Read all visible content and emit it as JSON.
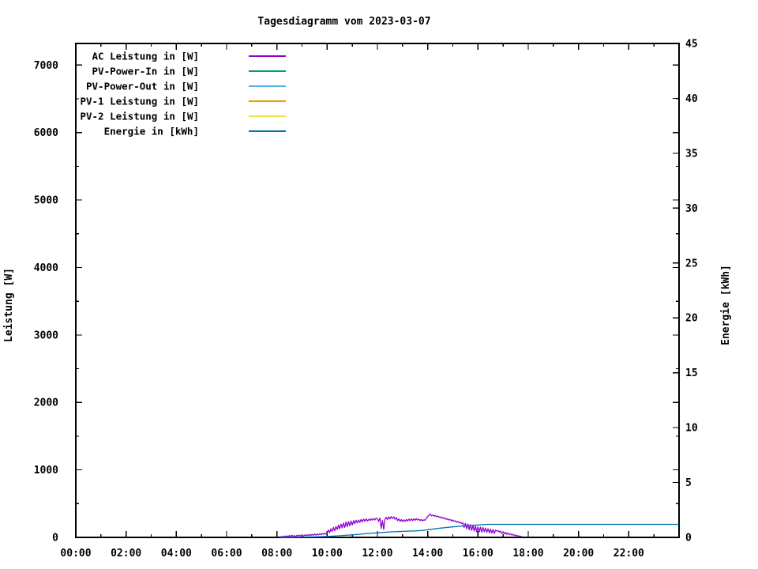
{
  "title": "Tagesdiagramm vom 2023-03-07",
  "chart_data": {
    "type": "line",
    "title": "Tagesdiagramm vom 2023-03-07",
    "grid": false,
    "legend_position": "top-left-inside",
    "x_axis": {
      "unit": "time of day",
      "range_hours": [
        0,
        24
      ],
      "major_tick_step_hours": 2,
      "minor_tick_step_hours": 1,
      "tick_labels": [
        "00:00",
        "02:00",
        "04:00",
        "06:00",
        "08:00",
        "10:00",
        "12:00",
        "14:00",
        "16:00",
        "18:00",
        "20:00",
        "22:00"
      ],
      "tick_label_hours": [
        0,
        2,
        4,
        6,
        8,
        10,
        12,
        14,
        16,
        18,
        20,
        22
      ]
    },
    "y_left": {
      "title": "Leistung [W]",
      "range": [
        0,
        7320
      ],
      "major_tick_step": 1000,
      "minor_tick_step": 500,
      "tick_values": [
        0,
        1000,
        2000,
        3000,
        4000,
        5000,
        6000,
        7000
      ],
      "tick_labels": [
        "0",
        "1000",
        "2000",
        "3000",
        "4000",
        "5000",
        "6000",
        "7000"
      ]
    },
    "y_right": {
      "title": "Energie [kWh]",
      "range": [
        0,
        45
      ],
      "major_tick_step": 5,
      "tick_values": [
        0,
        5,
        10,
        15,
        20,
        25,
        30,
        35,
        40,
        45
      ],
      "tick_labels": [
        "0",
        "5",
        "10",
        "15",
        "20",
        "25",
        "30",
        "35",
        "40",
        "45"
      ]
    },
    "series": [
      {
        "name": "AC Leistung in [W]",
        "color": "#9400d3",
        "axis": "left",
        "unit": "W",
        "note": "noisy daylight curve ~08:10-17:45, peak ~345 W around 14:05",
        "points": [
          [
            8.15,
            3
          ],
          [
            8.2,
            15
          ],
          [
            8.25,
            6
          ],
          [
            8.3,
            20
          ],
          [
            8.35,
            10
          ],
          [
            8.4,
            24
          ],
          [
            8.45,
            12
          ],
          [
            8.5,
            28
          ],
          [
            8.55,
            14
          ],
          [
            8.6,
            30
          ],
          [
            8.65,
            16
          ],
          [
            8.7,
            26
          ],
          [
            8.75,
            12
          ],
          [
            8.8,
            32
          ],
          [
            8.85,
            18
          ],
          [
            8.9,
            34
          ],
          [
            8.95,
            20
          ],
          [
            9.0,
            30
          ],
          [
            9.05,
            16
          ],
          [
            9.1,
            36
          ],
          [
            9.15,
            22
          ],
          [
            9.2,
            40
          ],
          [
            9.25,
            26
          ],
          [
            9.3,
            44
          ],
          [
            9.35,
            28
          ],
          [
            9.4,
            46
          ],
          [
            9.45,
            30
          ],
          [
            9.5,
            50
          ],
          [
            9.55,
            34
          ],
          [
            9.6,
            52
          ],
          [
            9.65,
            36
          ],
          [
            9.7,
            55
          ],
          [
            9.75,
            40
          ],
          [
            9.8,
            58
          ],
          [
            9.85,
            44
          ],
          [
            9.9,
            62
          ],
          [
            9.95,
            50
          ],
          [
            10.0,
            68
          ],
          [
            10.05,
            108
          ],
          [
            10.1,
            72
          ],
          [
            10.15,
            128
          ],
          [
            10.2,
            88
          ],
          [
            10.25,
            148
          ],
          [
            10.3,
            98
          ],
          [
            10.35,
            162
          ],
          [
            10.4,
            118
          ],
          [
            10.45,
            182
          ],
          [
            10.5,
            128
          ],
          [
            10.55,
            198
          ],
          [
            10.6,
            142
          ],
          [
            10.65,
            212
          ],
          [
            10.7,
            148
          ],
          [
            10.75,
            228
          ],
          [
            10.8,
            158
          ],
          [
            10.85,
            234
          ],
          [
            10.9,
            172
          ],
          [
            10.95,
            242
          ],
          [
            11.0,
            184
          ],
          [
            11.05,
            248
          ],
          [
            11.1,
            204
          ],
          [
            11.15,
            254
          ],
          [
            11.2,
            214
          ],
          [
            11.25,
            258
          ],
          [
            11.3,
            224
          ],
          [
            11.35,
            266
          ],
          [
            11.4,
            230
          ],
          [
            11.45,
            270
          ],
          [
            11.5,
            240
          ],
          [
            11.55,
            274
          ],
          [
            11.6,
            244
          ],
          [
            11.65,
            268
          ],
          [
            11.7,
            250
          ],
          [
            11.75,
            276
          ],
          [
            11.8,
            254
          ],
          [
            11.85,
            280
          ],
          [
            11.9,
            258
          ],
          [
            11.95,
            284
          ],
          [
            12.0,
            274
          ],
          [
            12.05,
            238
          ],
          [
            12.1,
            288
          ],
          [
            12.15,
            134
          ],
          [
            12.2,
            248
          ],
          [
            12.25,
            118
          ],
          [
            12.3,
            268
          ],
          [
            12.35,
            298
          ],
          [
            12.4,
            264
          ],
          [
            12.45,
            304
          ],
          [
            12.5,
            274
          ],
          [
            12.55,
            308
          ],
          [
            12.6,
            280
          ],
          [
            12.65,
            304
          ],
          [
            12.7,
            268
          ],
          [
            12.75,
            294
          ],
          [
            12.8,
            248
          ],
          [
            12.85,
            274
          ],
          [
            12.9,
            238
          ],
          [
            12.95,
            264
          ],
          [
            13.0,
            234
          ],
          [
            13.05,
            260
          ],
          [
            13.1,
            238
          ],
          [
            13.15,
            266
          ],
          [
            13.2,
            244
          ],
          [
            13.25,
            270
          ],
          [
            13.3,
            248
          ],
          [
            13.35,
            274
          ],
          [
            13.4,
            250
          ],
          [
            13.45,
            276
          ],
          [
            13.5,
            254
          ],
          [
            13.55,
            278
          ],
          [
            13.6,
            256
          ],
          [
            13.65,
            270
          ],
          [
            13.7,
            250
          ],
          [
            13.75,
            266
          ],
          [
            13.8,
            246
          ],
          [
            13.85,
            260
          ],
          [
            13.9,
            254
          ],
          [
            13.95,
            284
          ],
          [
            14.0,
            308
          ],
          [
            14.05,
            330
          ],
          [
            14.1,
            345
          ],
          [
            14.15,
            318
          ],
          [
            14.2,
            334
          ],
          [
            14.25,
            314
          ],
          [
            14.3,
            326
          ],
          [
            14.35,
            304
          ],
          [
            14.4,
            316
          ],
          [
            14.45,
            296
          ],
          [
            14.5,
            306
          ],
          [
            14.55,
            286
          ],
          [
            14.6,
            296
          ],
          [
            14.65,
            276
          ],
          [
            14.7,
            286
          ],
          [
            14.75,
            266
          ],
          [
            14.8,
            276
          ],
          [
            14.85,
            256
          ],
          [
            14.9,
            266
          ],
          [
            14.95,
            246
          ],
          [
            15.0,
            256
          ],
          [
            15.05,
            236
          ],
          [
            15.1,
            246
          ],
          [
            15.15,
            226
          ],
          [
            15.2,
            236
          ],
          [
            15.25,
            216
          ],
          [
            15.3,
            226
          ],
          [
            15.35,
            206
          ],
          [
            15.4,
            216
          ],
          [
            15.45,
            148
          ],
          [
            15.5,
            208
          ],
          [
            15.55,
            128
          ],
          [
            15.6,
            198
          ],
          [
            15.65,
            114
          ],
          [
            15.7,
            188
          ],
          [
            15.75,
            104
          ],
          [
            15.8,
            178
          ],
          [
            15.85,
            94
          ],
          [
            15.9,
            168
          ],
          [
            15.95,
            86
          ],
          [
            16.0,
            158
          ],
          [
            16.05,
            80
          ],
          [
            16.1,
            152
          ],
          [
            16.15,
            76
          ],
          [
            16.2,
            146
          ],
          [
            16.25,
            84
          ],
          [
            16.3,
            138
          ],
          [
            16.35,
            74
          ],
          [
            16.4,
            128
          ],
          [
            16.45,
            68
          ],
          [
            16.5,
            122
          ],
          [
            16.55,
            64
          ],
          [
            16.6,
            116
          ],
          [
            16.65,
            58
          ],
          [
            16.7,
            108
          ],
          [
            16.75,
            92
          ],
          [
            16.8,
            102
          ],
          [
            16.85,
            78
          ],
          [
            16.9,
            94
          ],
          [
            16.95,
            58
          ],
          [
            17.0,
            84
          ],
          [
            17.05,
            54
          ],
          [
            17.1,
            74
          ],
          [
            17.15,
            46
          ],
          [
            17.2,
            64
          ],
          [
            17.25,
            40
          ],
          [
            17.3,
            54
          ],
          [
            17.35,
            34
          ],
          [
            17.4,
            44
          ],
          [
            17.45,
            26
          ],
          [
            17.5,
            36
          ],
          [
            17.55,
            20
          ],
          [
            17.6,
            26
          ],
          [
            17.65,
            14
          ],
          [
            17.7,
            16
          ],
          [
            17.75,
            6
          ]
        ]
      },
      {
        "name": "PV-Power-In in [W]",
        "color": "#009e73",
        "axis": "left",
        "unit": "W",
        "note": "no visible curve (0 all day)",
        "points": []
      },
      {
        "name": "PV-Power-Out in [W]",
        "color": "#56b4e9",
        "axis": "left",
        "unit": "W",
        "note": "no visible curve (0 all day)",
        "points": []
      },
      {
        "name": "PV-1 Leistung in [W]",
        "color": "#e69f00",
        "axis": "left",
        "unit": "W",
        "note": "no visible curve (0 all day)",
        "points": []
      },
      {
        "name": "PV-2 Leistung in [W]",
        "color": "#f0e442",
        "axis": "left",
        "unit": "W",
        "note": "no visible curve (0 all day)",
        "points": []
      },
      {
        "name": "Energie in [kWh]",
        "color": "#0072b2",
        "axis": "right",
        "unit": "kWh",
        "note": "cumulative energy, rises from ~08:15 to plateau ~1.19 kWh at ~16:25",
        "points": [
          [
            8.15,
            0
          ],
          [
            8.5,
            0.01
          ],
          [
            9.0,
            0.03
          ],
          [
            9.5,
            0.05
          ],
          [
            10.0,
            0.09
          ],
          [
            10.5,
            0.15
          ],
          [
            11.0,
            0.23
          ],
          [
            11.5,
            0.33
          ],
          [
            12.0,
            0.42
          ],
          [
            12.5,
            0.5
          ],
          [
            13.0,
            0.55
          ],
          [
            13.5,
            0.59
          ],
          [
            13.75,
            0.63
          ],
          [
            14.0,
            0.7
          ],
          [
            14.25,
            0.77
          ],
          [
            14.5,
            0.84
          ],
          [
            14.75,
            0.9
          ],
          [
            15.0,
            0.96
          ],
          [
            15.25,
            1.01
          ],
          [
            15.5,
            1.06
          ],
          [
            15.75,
            1.1
          ],
          [
            16.0,
            1.13
          ],
          [
            16.1,
            1.15
          ],
          [
            16.25,
            1.17
          ],
          [
            16.4,
            1.19
          ],
          [
            24.0,
            1.19
          ]
        ]
      }
    ],
    "colors": {
      "border": "#000000",
      "text": "#000000",
      "background": "#ffffff"
    }
  }
}
